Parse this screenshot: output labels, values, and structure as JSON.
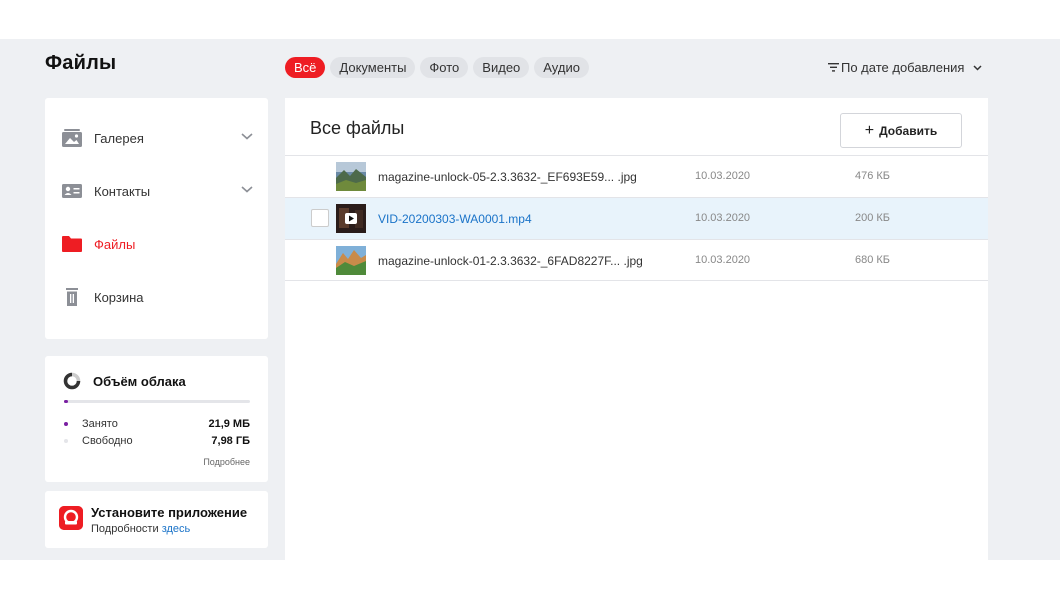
{
  "header": {
    "title": "Файлы"
  },
  "filters": [
    {
      "label": "Всё",
      "active": true
    },
    {
      "label": "Документы",
      "active": false
    },
    {
      "label": "Фото",
      "active": false
    },
    {
      "label": "Видео",
      "active": false
    },
    {
      "label": "Аудио",
      "active": false
    }
  ],
  "sort": {
    "label": "По дате добавления"
  },
  "sidebar": {
    "items": [
      {
        "label": "Галерея",
        "icon": "gallery-icon",
        "expandable": true,
        "active": false
      },
      {
        "label": "Контакты",
        "icon": "contacts-icon",
        "expandable": true,
        "active": false
      },
      {
        "label": "Файлы",
        "icon": "folder-icon",
        "expandable": false,
        "active": true
      },
      {
        "label": "Корзина",
        "icon": "trash-icon",
        "expandable": false,
        "active": false
      }
    ]
  },
  "storage": {
    "title": "Объём облака",
    "used_label": "Занято",
    "used_value": "21,9 МБ",
    "free_label": "Свободно",
    "free_value": "7,98 ГБ",
    "more_link": "Подробнее",
    "used_fraction": 0.003
  },
  "app_promo": {
    "title": "Установите приложение",
    "subtitle": "Подробности",
    "link": "здесь"
  },
  "main": {
    "title": "Все файлы",
    "add_button": "Добавить",
    "files": [
      {
        "name": "magazine-unlock-05-2.3.3632-_EF693E59... .jpg",
        "date": "10.03.2020",
        "size": "476 КБ",
        "type": "image",
        "selected": false
      },
      {
        "name": "VID-20200303-WA0001.mp4",
        "date": "10.03.2020",
        "size": "200 КБ",
        "type": "video",
        "selected": true
      },
      {
        "name": "magazine-unlock-01-2.3.3632-_6FAD8227F... .jpg",
        "date": "10.03.2020",
        "size": "680 КБ",
        "type": "image",
        "selected": false
      }
    ]
  },
  "colors": {
    "accent": "#ee1d23",
    "link": "#1a73c8",
    "background": "#eef0f3",
    "selected_row": "#e8f3fb",
    "used_dot": "#7a1fa2"
  }
}
